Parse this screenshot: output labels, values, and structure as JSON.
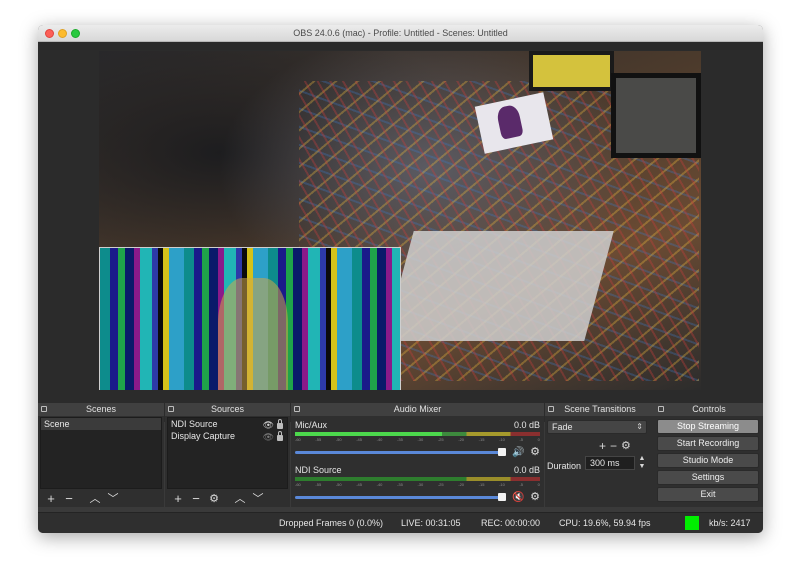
{
  "window": {
    "title": "OBS 24.0.6 (mac) - Profile: Untitled - Scenes: Untitled"
  },
  "docks": {
    "scenes": {
      "title": "Scenes",
      "items": [
        "Scene"
      ]
    },
    "sources": {
      "title": "Sources",
      "items": [
        {
          "label": "NDI Source",
          "visible": true,
          "locked": true
        },
        {
          "label": "Display Capture",
          "visible": false,
          "locked": true
        }
      ]
    },
    "mixer": {
      "title": "Audio Mixer",
      "scale": [
        "-60",
        "-55",
        "-50",
        "-45",
        "-40",
        "-35",
        "-30",
        "-25",
        "-20",
        "-15",
        "-10",
        "-5",
        "0"
      ],
      "channels": [
        {
          "name": "Mic/Aux",
          "db": "0.0 dB",
          "muted": false
        },
        {
          "name": "NDI Source",
          "db": "0.0 dB",
          "muted": true
        }
      ]
    },
    "transitions": {
      "title": "Scene Transitions",
      "selected": "Fade",
      "duration_label": "Duration",
      "duration_value": "300 ms"
    },
    "controls": {
      "title": "Controls",
      "buttons": [
        "Stop Streaming",
        "Start Recording",
        "Studio Mode",
        "Settings",
        "Exit"
      ]
    }
  },
  "status": {
    "dropped_frames": "Dropped Frames 0 (0.0%)",
    "live": "LIVE: 00:31:05",
    "rec": "REC: 00:00:00",
    "cpu": "CPU: 19.6%, 59.94 fps",
    "kbps": "kb/s: 2417",
    "indicator_color": "#00ee00"
  },
  "colors": {
    "accent": "#5a88d8",
    "muted": "#e04040"
  }
}
